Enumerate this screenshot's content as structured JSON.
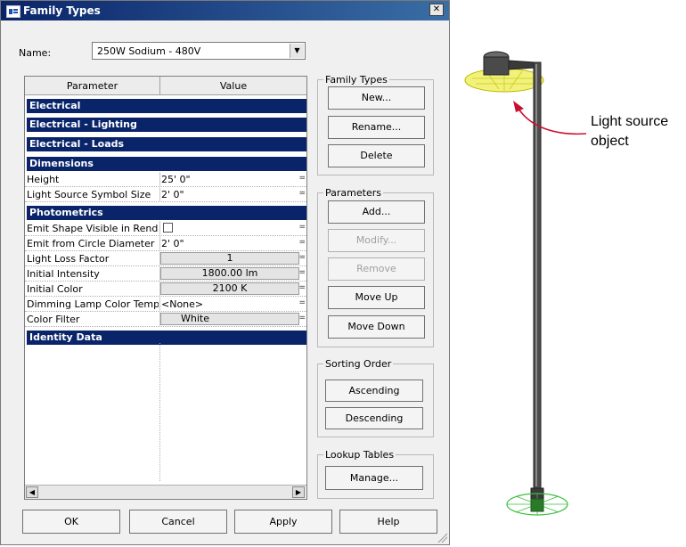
{
  "dialog": {
    "title": "Family Types",
    "name_label": "Name:",
    "name_value": "250W Sodium - 480V"
  },
  "grid": {
    "columns": [
      "Parameter",
      "Value"
    ],
    "groups": {
      "electrical": "Electrical",
      "electrical_lighting": "Electrical - Lighting",
      "electrical_loads": "Electrical - Loads",
      "dimensions": "Dimensions",
      "photometrics": "Photometrics",
      "identity_data": "Identity Data"
    },
    "dimensions": [
      {
        "name": "Height",
        "value": "25'  0\""
      },
      {
        "name": "Light Source Symbol Size",
        "value": "2'  0\""
      }
    ],
    "photometrics": [
      {
        "name": "Emit Shape Visible in Rende",
        "value": ""
      },
      {
        "name": "Emit from Circle Diameter",
        "value": "2'  0\""
      },
      {
        "name": "Light Loss Factor",
        "value": "1"
      },
      {
        "name": "Initial Intensity",
        "value": "1800.00 lm"
      },
      {
        "name": "Initial Color",
        "value": "2100 K"
      },
      {
        "name": "Dimming Lamp Color Tempe",
        "value": "<None>"
      },
      {
        "name": "Color Filter",
        "value": "White"
      }
    ],
    "row_suffix": "="
  },
  "groups": {
    "family_types": {
      "label": "Family Types",
      "new": "New...",
      "rename": "Rename...",
      "delete": "Delete"
    },
    "parameters": {
      "label": "Parameters",
      "add": "Add...",
      "modify": "Modify...",
      "remove": "Remove",
      "move_up": "Move Up",
      "move_down": "Move Down"
    },
    "sorting": {
      "label": "Sorting Order",
      "ascending": "Ascending",
      "descending": "Descending"
    },
    "lookup": {
      "label": "Lookup Tables",
      "manage": "Manage..."
    }
  },
  "footer": {
    "ok": "OK",
    "cancel": "Cancel",
    "apply": "Apply",
    "help": "Help"
  },
  "annotation": {
    "line1": "Light source",
    "line2": "object"
  },
  "colors": {
    "group_header": "#0a246a",
    "light_fill": "#f2f27a",
    "arrow": "#c8102e",
    "emitter": "#3fbf3f"
  }
}
